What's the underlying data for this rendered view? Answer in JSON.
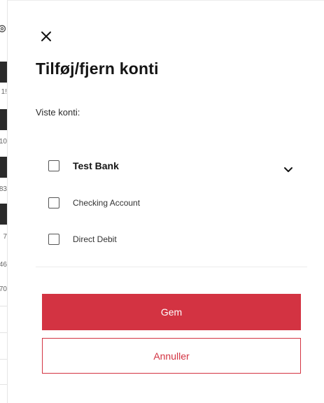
{
  "dialog": {
    "close_icon": "close-icon",
    "title": "Tilføj/fjern konti",
    "subtitle": "Viste konti:",
    "accounts": [
      {
        "label": "Test Bank",
        "checked": false,
        "group": true,
        "expand_icon": "chevron-down-icon"
      },
      {
        "label": "Checking Account",
        "checked": false,
        "group": false
      },
      {
        "label": "Direct Debit",
        "checked": false,
        "group": false
      }
    ],
    "save_label": "Gem",
    "cancel_label": "Annuller",
    "colors": {
      "accent": "#d33342",
      "text": "#141414",
      "divider": "#ececec"
    }
  },
  "background": {
    "numbers": [
      "1!",
      "10",
      "83",
      "7",
      "46",
      "70"
    ]
  }
}
